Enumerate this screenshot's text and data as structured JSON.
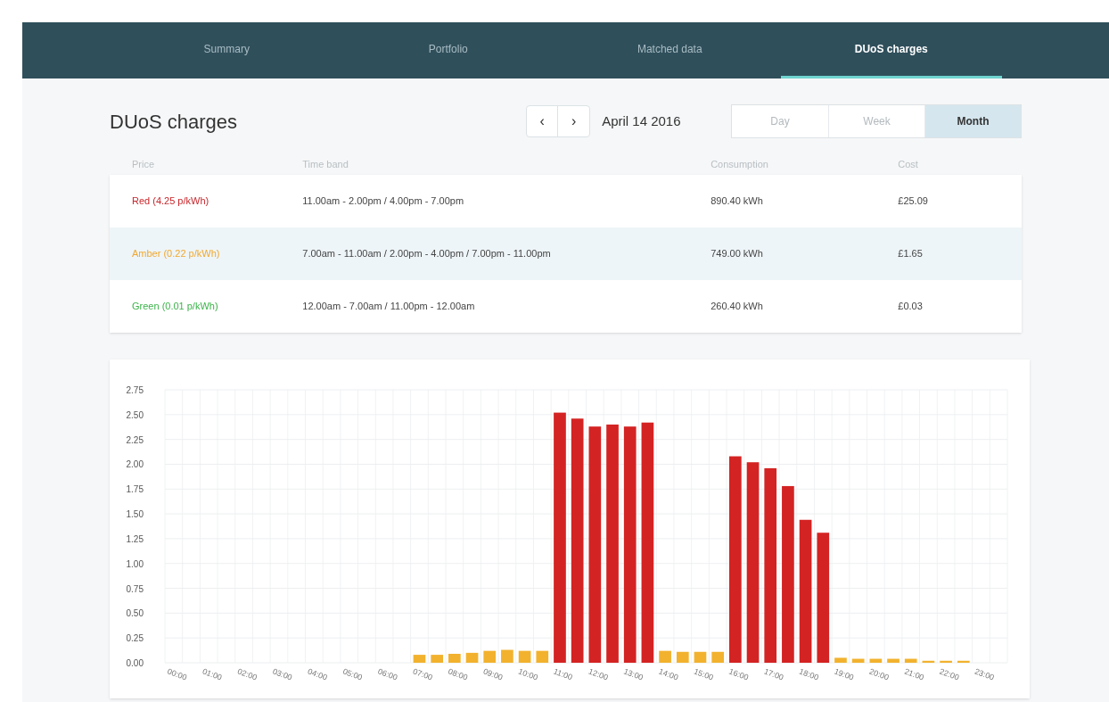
{
  "tabs": [
    {
      "label": "Summary",
      "selected": false
    },
    {
      "label": "Portfolio",
      "selected": false
    },
    {
      "label": "Matched data",
      "selected": false
    },
    {
      "label": "DUoS charges",
      "selected": true
    }
  ],
  "header": {
    "title": "DUoS charges",
    "prev": "‹",
    "next": "›",
    "date": "April 14 2016",
    "periods": [
      {
        "label": "Day",
        "selected": false
      },
      {
        "label": "Week",
        "selected": false
      },
      {
        "label": "Month",
        "selected": true
      }
    ]
  },
  "table": {
    "columns": [
      "Price",
      "Time band",
      "Consumption",
      "Cost"
    ],
    "rows": [
      {
        "price": "Red (4.25 p/kWh)",
        "color": "#c8262b",
        "time_band": "11.00am - 2.00pm / 4.00pm - 7.00pm",
        "consumption": "890.40 kWh",
        "cost": "£25.09",
        "selected": false
      },
      {
        "price": "Amber (0.22 p/kWh)",
        "color": "#f0a830",
        "time_band": "7.00am - 11.00am / 2.00pm - 4.00pm / 7.00pm - 11.00pm",
        "consumption": "749.00 kWh",
        "cost": "£1.65",
        "selected": true
      },
      {
        "price": "Green (0.01 p/kWh)",
        "color": "#3cb34a",
        "time_band": "12.00am - 7.00am / 11.00pm - 12.00am",
        "consumption": "260.40 kWh",
        "cost": "£0.03",
        "selected": false
      }
    ]
  },
  "chart_data": {
    "type": "bar",
    "grid": true,
    "xlim": [
      0,
      24
    ],
    "x": [
      7.25,
      7.75,
      8.25,
      8.75,
      9.25,
      9.75,
      10.25,
      10.75,
      11.25,
      11.75,
      12.25,
      12.75,
      13.25,
      13.75,
      14.25,
      14.75,
      15.25,
      15.75,
      16.25,
      16.75,
      17.25,
      17.75,
      18.25,
      18.75,
      19.25,
      19.75,
      20.25,
      20.75,
      21.25,
      21.75,
      22.25,
      22.75
    ],
    "series": [
      {
        "color": "#d42323",
        "values": [
          null,
          null,
          null,
          null,
          null,
          null,
          null,
          null,
          2.52,
          2.46,
          2.38,
          2.4,
          2.38,
          2.42,
          null,
          null,
          null,
          null,
          2.08,
          2.02,
          1.96,
          1.78,
          1.44,
          1.31,
          null,
          null,
          null,
          null,
          null,
          null,
          null,
          null
        ]
      },
      {
        "color": "#f2b22e",
        "values": [
          0.08,
          0.08,
          0.09,
          0.1,
          0.12,
          0.13,
          0.12,
          0.12,
          null,
          null,
          null,
          null,
          null,
          null,
          0.12,
          0.11,
          0.11,
          0.11,
          null,
          null,
          null,
          null,
          null,
          null,
          0.05,
          0.04,
          0.04,
          0.04,
          0.04,
          0.02,
          0.02,
          0.02
        ]
      }
    ],
    "ylim": [
      0,
      2.75
    ],
    "yticks": [
      {
        "value": 0,
        "label": "0.00"
      },
      {
        "value": 0.25,
        "label": "0.25"
      },
      {
        "value": 0.5,
        "label": "0.50"
      },
      {
        "value": 0.75,
        "label": "0.75"
      },
      {
        "value": 1,
        "label": "1.00"
      },
      {
        "value": 1.25,
        "label": "1.25"
      },
      {
        "value": 1.5,
        "label": "1.50"
      },
      {
        "value": 1.75,
        "label": "1.75"
      },
      {
        "value": 2,
        "label": "2.00"
      },
      {
        "value": 2.25,
        "label": "2.25"
      },
      {
        "value": 2.5,
        "label": "2.50"
      },
      {
        "value": 2.75,
        "label": "2.75"
      }
    ],
    "xticks": [
      {
        "value": 0,
        "label": "00:00"
      },
      {
        "value": 1,
        "label": "01:00"
      },
      {
        "value": 2,
        "label": "02:00"
      },
      {
        "value": 3,
        "label": "03:00"
      },
      {
        "value": 4,
        "label": "04:00"
      },
      {
        "value": 5,
        "label": "05:00"
      },
      {
        "value": 6,
        "label": "06:00"
      },
      {
        "value": 7,
        "label": "07:00"
      },
      {
        "value": 8,
        "label": "08:00"
      },
      {
        "value": 9,
        "label": "09:00"
      },
      {
        "value": 10,
        "label": "10:00"
      },
      {
        "value": 11,
        "label": "11:00"
      },
      {
        "value": 12,
        "label": "12:00"
      },
      {
        "value": 13,
        "label": "13:00"
      },
      {
        "value": 14,
        "label": "14:00"
      },
      {
        "value": 15,
        "label": "15:00"
      },
      {
        "value": 16,
        "label": "16:00"
      },
      {
        "value": 17,
        "label": "17:00"
      },
      {
        "value": 18,
        "label": "18:00"
      },
      {
        "value": 19,
        "label": "19:00"
      },
      {
        "value": 20,
        "label": "20:00"
      },
      {
        "value": 21,
        "label": "21:00"
      },
      {
        "value": 22,
        "label": "22:00"
      },
      {
        "value": 23,
        "label": "23:00"
      }
    ]
  }
}
